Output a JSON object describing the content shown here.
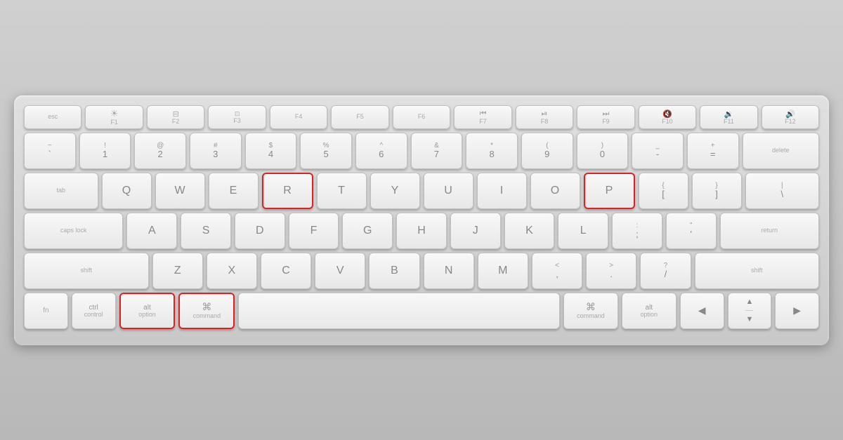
{
  "keyboard": {
    "rows": [
      {
        "id": "fn",
        "keys": [
          {
            "label": "esc",
            "type": "fn"
          },
          {
            "top": "☀",
            "bottom": "F1",
            "type": "fn"
          },
          {
            "top": "⊟",
            "bottom": "F2",
            "type": "fn"
          },
          {
            "top": "⓪",
            "bottom": "F3",
            "type": "fn"
          },
          {
            "top": "",
            "bottom": "F4",
            "type": "fn"
          },
          {
            "top": "",
            "bottom": "F5",
            "type": "fn"
          },
          {
            "top": "",
            "bottom": "F6",
            "type": "fn"
          },
          {
            "top": "◀◀",
            "bottom": "F7",
            "type": "fn"
          },
          {
            "top": "▶❚❚",
            "bottom": "F8",
            "type": "fn"
          },
          {
            "top": "▶▶",
            "bottom": "F9",
            "type": "fn"
          },
          {
            "top": "🔇",
            "bottom": "F10",
            "type": "fn"
          },
          {
            "top": "🔉",
            "bottom": "F11",
            "type": "fn"
          },
          {
            "top": "🔊",
            "bottom": "F12",
            "type": "fn"
          }
        ]
      },
      {
        "id": "number",
        "keys": [
          {
            "top": "~",
            "bottom": "`"
          },
          {
            "top": "!",
            "bottom": "1"
          },
          {
            "top": "@",
            "bottom": "2"
          },
          {
            "top": "#",
            "bottom": "3"
          },
          {
            "top": "$",
            "bottom": "4"
          },
          {
            "top": "%",
            "bottom": "5"
          },
          {
            "top": "^",
            "bottom": "6"
          },
          {
            "top": "&",
            "bottom": "7"
          },
          {
            "top": "*",
            "bottom": "8"
          },
          {
            "top": "(",
            "bottom": "9"
          },
          {
            "top": ")",
            "bottom": "0"
          },
          {
            "top": "_",
            "bottom": "-"
          },
          {
            "top": "+",
            "bottom": "="
          },
          {
            "label": "delete",
            "wide": "wide-15"
          }
        ]
      },
      {
        "id": "qwerty",
        "keys": [
          {
            "label": "tab",
            "wide": "wide-15"
          },
          {
            "main": "Q"
          },
          {
            "main": "W"
          },
          {
            "main": "E"
          },
          {
            "main": "R",
            "highlighted": true
          },
          {
            "main": "T"
          },
          {
            "main": "Y"
          },
          {
            "main": "U"
          },
          {
            "main": "I"
          },
          {
            "main": "O"
          },
          {
            "main": "P",
            "highlighted": true
          },
          {
            "top": "{",
            "bottom": "["
          },
          {
            "top": "}",
            "bottom": "]"
          },
          {
            "top": "|",
            "bottom": "\\",
            "wide": "wide-15"
          }
        ]
      },
      {
        "id": "asdf",
        "keys": [
          {
            "label": "caps lock",
            "wide": "wide-2"
          },
          {
            "main": "A"
          },
          {
            "main": "S"
          },
          {
            "main": "D"
          },
          {
            "main": "F"
          },
          {
            "main": "G"
          },
          {
            "main": "H"
          },
          {
            "main": "J"
          },
          {
            "main": "K"
          },
          {
            "main": "L"
          },
          {
            "top": ":",
            "bottom": ";"
          },
          {
            "top": "\"",
            "bottom": "'"
          },
          {
            "label": "return",
            "wide": "wide-2"
          }
        ]
      },
      {
        "id": "zxcv",
        "keys": [
          {
            "label": "shift",
            "wide": "wide-25"
          },
          {
            "main": "Z"
          },
          {
            "main": "X"
          },
          {
            "main": "C"
          },
          {
            "main": "V"
          },
          {
            "main": "B"
          },
          {
            "main": "N"
          },
          {
            "main": "M"
          },
          {
            "top": "<",
            "bottom": ","
          },
          {
            "top": ">",
            "bottom": "."
          },
          {
            "top": "?",
            "bottom": "/"
          },
          {
            "label": "shift",
            "wide": "wide-25"
          }
        ]
      },
      {
        "id": "bottom",
        "keys": [
          {
            "top": "fn",
            "bottom": "",
            "narrow": "narrow-07"
          },
          {
            "top": "ctrl",
            "bottom": "control",
            "narrow": "narrow-07"
          },
          {
            "top": "alt",
            "bottom": "option",
            "highlighted": true
          },
          {
            "top": "⌘",
            "bottom": "command",
            "highlighted": true
          },
          {
            "label": "",
            "wide": "spacebar"
          },
          {
            "top": "⌘",
            "bottom": "command"
          },
          {
            "top": "alt",
            "bottom": "option"
          },
          {
            "label": "◀",
            "narrow": "narrow-07"
          },
          {
            "label": "▲▼",
            "narrow": "narrow-07"
          },
          {
            "label": "▶",
            "narrow": "narrow-07"
          }
        ]
      }
    ]
  }
}
